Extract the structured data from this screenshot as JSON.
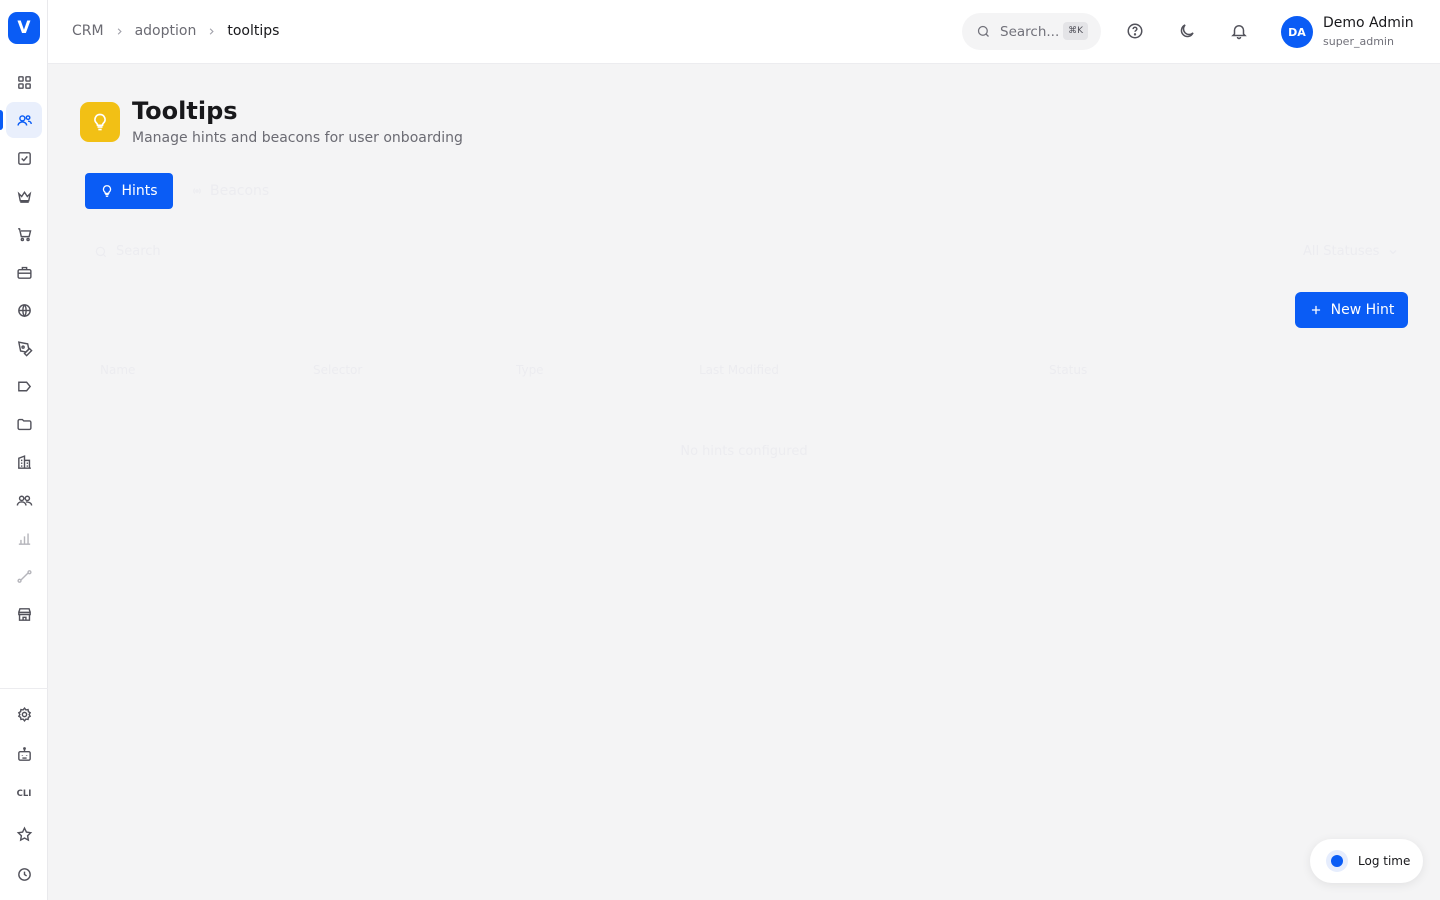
{
  "brand": {
    "logo_letter": "V",
    "accent": "#0a5cf5"
  },
  "sidebar": {
    "items": [
      {
        "icon": "grid-icon"
      },
      {
        "icon": "users-icon",
        "active": true
      },
      {
        "icon": "checkbox-icon"
      },
      {
        "icon": "crown-icon"
      },
      {
        "icon": "cart-icon"
      },
      {
        "icon": "briefcase-icon"
      },
      {
        "icon": "globe-icon"
      },
      {
        "icon": "pen-tool-icon"
      },
      {
        "icon": "megaphone-icon"
      },
      {
        "icon": "folder-icon"
      },
      {
        "icon": "building-icon"
      },
      {
        "icon": "team-icon"
      },
      {
        "icon": "bar-chart-icon"
      },
      {
        "icon": "route-icon"
      },
      {
        "icon": "store-icon"
      }
    ],
    "bottom_items": [
      {
        "icon": "settings-icon"
      },
      {
        "icon": "bot-icon"
      },
      {
        "icon": "cli-icon",
        "label": "CLI"
      },
      {
        "icon": "star-icon"
      },
      {
        "icon": "clock-icon"
      }
    ]
  },
  "header": {
    "breadcrumb": [
      "CRM",
      "adoption",
      "tooltips"
    ],
    "search": {
      "placeholder": "Search...",
      "shortcut": "⌘K"
    },
    "user": {
      "initials": "DA",
      "name": "Demo Admin",
      "role": "super_admin"
    }
  },
  "page": {
    "title": "Tooltips",
    "subtitle": "Manage hints and beacons for user onboarding",
    "tabs": [
      {
        "label": "Hints",
        "active": true
      },
      {
        "label": "Beacons",
        "active": false
      }
    ],
    "filters": {
      "search_placeholder": "Search",
      "status_select": "All Statuses"
    },
    "new_button": "New Hint",
    "table": {
      "columns": [
        "Name",
        "Selector",
        "Type",
        "Last Modified",
        "Status"
      ],
      "empty_message": "No hints configured"
    }
  },
  "log_time": {
    "label": "Log time"
  }
}
